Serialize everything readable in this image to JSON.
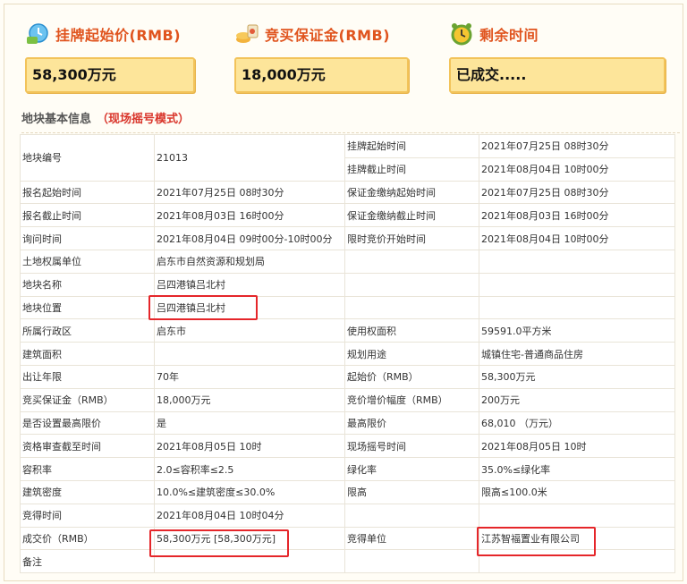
{
  "header": {
    "start_price": {
      "label": "挂牌起始价(RMB)",
      "value": "58,300万元",
      "icon": "money-clock-icon"
    },
    "deposit": {
      "label": "竞买保证金(RMB)",
      "value": "18,000万元",
      "icon": "coins-icon"
    },
    "remaining": {
      "label": "剩余时间",
      "value": "已成交.....",
      "icon": "alarm-clock-icon"
    }
  },
  "section": {
    "title": "地块基本信息",
    "mode": "（现场摇号模式）"
  },
  "table": {
    "parcel_no_label": "地块编号",
    "parcel_no": "21013",
    "list_start_label": "挂牌起始时间",
    "list_start": "2021年07月25日 08时30分",
    "list_end_label": "挂牌截止时间",
    "list_end": "2021年08月04日 10时00分",
    "rows": [
      [
        "报名起始时间",
        "2021年07月25日 08时30分",
        "保证金缴纳起始时间",
        "2021年07月25日 08时30分"
      ],
      [
        "报名截止时间",
        "2021年08月03日 16时00分",
        "保证金缴纳截止时间",
        "2021年08月03日 16时00分"
      ],
      [
        "询问时间",
        "2021年08月04日 09时00分-10时00分",
        "限时竞价开始时间",
        "2021年08月04日 10时00分"
      ],
      [
        "土地权属单位",
        "启东市自然资源和规划局",
        "",
        ""
      ],
      [
        "地块名称",
        "吕四港镇吕北村",
        "",
        ""
      ],
      [
        "地块位置",
        "吕四港镇吕北村",
        "",
        ""
      ],
      [
        "所属行政区",
        "启东市",
        "使用权面积",
        "59591.0平方米"
      ],
      [
        "建筑面积",
        "",
        "规划用途",
        "城镇住宅-普通商品住房"
      ],
      [
        "出让年限",
        "70年",
        "起始价（RMB）",
        "58,300万元"
      ],
      [
        "竞买保证金（RMB）",
        "18,000万元",
        "竞价增价幅度（RMB）",
        "200万元"
      ],
      [
        "是否设置最高限价",
        "是",
        "最高限价",
        "68,010 （万元）"
      ],
      [
        "资格审查截至时间",
        "2021年08月05日 10时",
        "现场摇号时间",
        "2021年08月05日 10时"
      ],
      [
        "容积率",
        "2.0≤容积率≤2.5",
        "绿化率",
        "35.0%≤绿化率"
      ],
      [
        "建筑密度",
        "10.0%≤建筑密度≤30.0%",
        "限高",
        "限高≤100.0米"
      ],
      [
        "竞得时间",
        "2021年08月04日 10时04分",
        "",
        ""
      ],
      [
        "成交价（RMB）",
        "58,300万元 [58,300万元]",
        "竞得单位",
        "江苏智福置业有限公司"
      ],
      [
        "备注",
        "",
        "",
        ""
      ]
    ]
  },
  "colors": {
    "accent": "#e0541e",
    "highlight": "#e5262a",
    "box_fill": "#fde59a"
  }
}
